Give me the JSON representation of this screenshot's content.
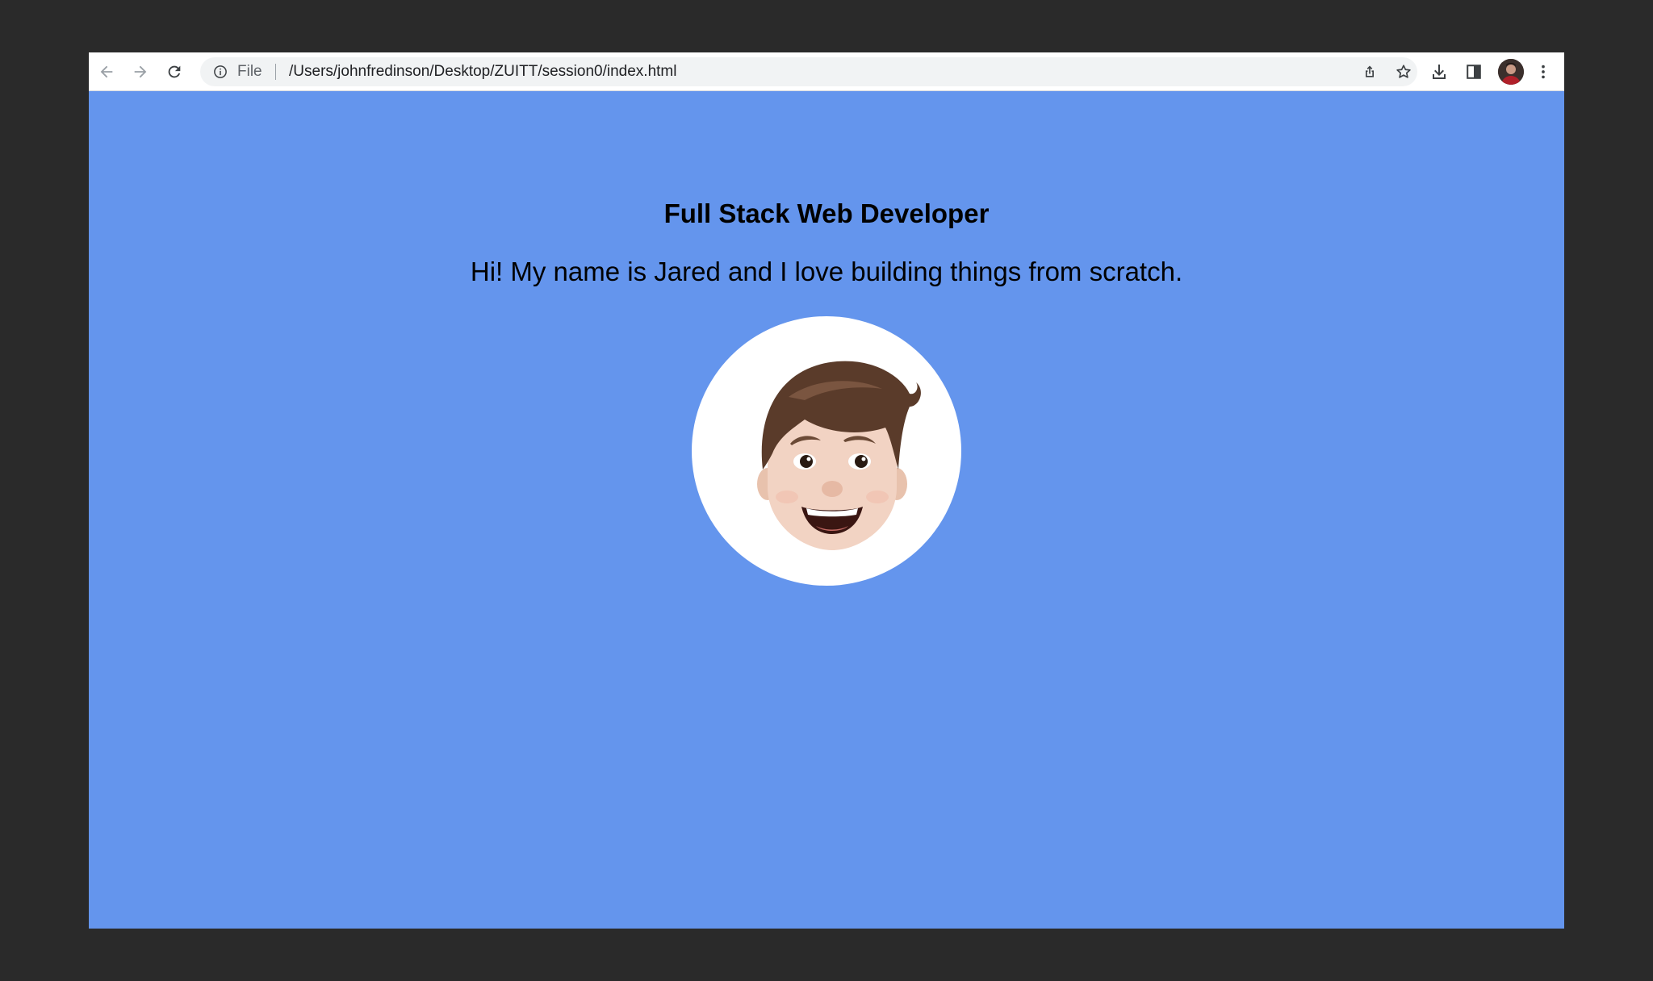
{
  "browser": {
    "scheme_label": "File",
    "url": "/Users/johnfredinson/Desktop/ZUITT/session0/index.html",
    "icons": {
      "back": "back-arrow-icon",
      "forward": "forward-arrow-icon",
      "reload": "reload-icon",
      "info": "info-icon",
      "share": "share-icon",
      "bookmark": "star-icon",
      "download": "download-icon",
      "side_panel": "side-panel-icon",
      "menu": "more-vert-icon"
    }
  },
  "page": {
    "title": "Full Stack Web Developer",
    "bio": "Hi! My name is Jared and I love building things from scratch.",
    "background_color": "#6495ed",
    "photo_background": "#ffffff"
  }
}
